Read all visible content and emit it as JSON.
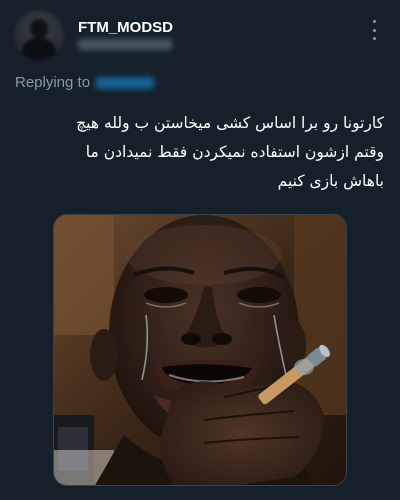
{
  "author": {
    "display_name": "FTM_MODSD",
    "handle_redacted": true,
    "avatar_icon": "profile-avatar"
  },
  "reply": {
    "label": "Replying to",
    "mention_redacted": true
  },
  "tweet": {
    "lines": [
      "کارتونا رو برا اساس کشی میخاستن ب ولله هیچ",
      "وقتم ازشون استفاده نمیکردن فقط نمیدادن ما",
      "باهاش بازی کنیم"
    ]
  },
  "media": {
    "icon": "crying-man-with-cigarette-photo"
  },
  "colors": {
    "background": "#15202b",
    "secondary_text": "#8899a6",
    "primary_text": "#ffffff",
    "link": "#1d9bf0"
  },
  "icons": {
    "more": "more-vertical-icon"
  }
}
